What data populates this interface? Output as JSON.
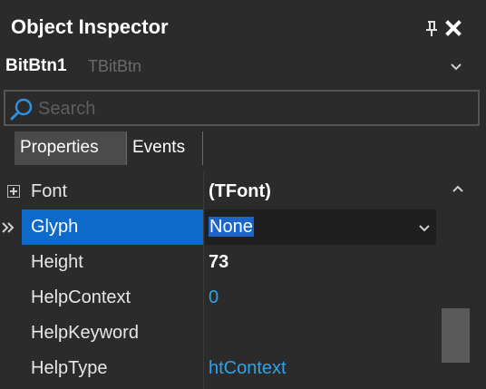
{
  "window": {
    "title": "Object Inspector"
  },
  "component": {
    "name": "BitBtn1",
    "type": "TBitBtn"
  },
  "search": {
    "placeholder": "Search",
    "value": ""
  },
  "tabs": [
    {
      "label": "Properties",
      "active": true
    },
    {
      "label": "Events",
      "active": false
    }
  ],
  "properties": [
    {
      "name": "Font",
      "value": "(TFont)",
      "expandable": true
    },
    {
      "name": "Glyph",
      "value": "None",
      "selected": true
    },
    {
      "name": "Height",
      "value": "73"
    },
    {
      "name": "HelpContext",
      "value": "0"
    },
    {
      "name": "HelpKeyword",
      "value": ""
    },
    {
      "name": "HelpType",
      "value": "htContext"
    }
  ],
  "colors": {
    "background": "#2b2b2b",
    "selection": "#0d6ac9",
    "value_blue": "#2fa2e8",
    "muted": "#6a6a6a"
  },
  "icons": {
    "pin": "pin-icon",
    "close": "close-icon",
    "search": "search-icon",
    "chevron": "chevron-down-icon",
    "expand": "expand-plus-icon",
    "row_marker": "double-chevron-right-icon",
    "scroll_up": "chevron-up-icon"
  }
}
